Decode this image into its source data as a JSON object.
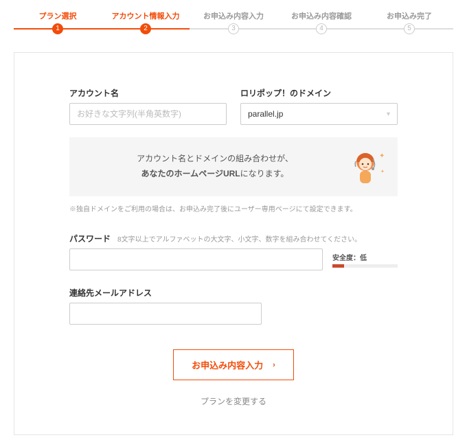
{
  "stepper": {
    "steps": [
      {
        "label": "プラン選択",
        "active": true
      },
      {
        "label": "アカウント情報入力",
        "active": true
      },
      {
        "label": "お申込み内容入力",
        "active": false
      },
      {
        "label": "お申込み内容確認",
        "active": false
      },
      {
        "label": "お申込み完了",
        "active": false
      }
    ]
  },
  "account": {
    "label": "アカウント名",
    "placeholder": "お好きな文字列(半角英数字)"
  },
  "domain": {
    "label": "ロリポップ！のドメイン",
    "value": "parallel.jp"
  },
  "info": {
    "line1": "アカウント名とドメインの組み合わせが、",
    "line2_bold": "あなたのホームページURL",
    "line2_rest": "になります。"
  },
  "note": "※独自ドメインをご利用の場合は、お申込み完了後にユーザー専用ページにて設定できます。",
  "password": {
    "label": "パスワード",
    "hint": "8文字以上でアルファベットの大文字、小文字、数字を組み合わせてください。",
    "strength_label": "安全度：低"
  },
  "email": {
    "label": "連絡先メールアドレス"
  },
  "actions": {
    "submit": "お申込み内容入力",
    "change_plan": "プランを変更する"
  }
}
